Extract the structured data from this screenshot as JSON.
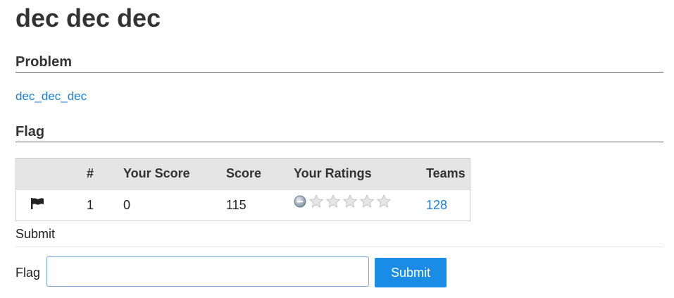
{
  "page": {
    "title": "dec dec dec"
  },
  "problem": {
    "heading": "Problem",
    "link_text": "dec_dec_dec"
  },
  "flag_section": {
    "heading": "Flag",
    "table": {
      "columns": [
        "",
        "#",
        "Your Score",
        "Score",
        "Your Ratings",
        "Teams"
      ],
      "rows": [
        {
          "icon": "flag-icon",
          "number": "1",
          "your_score": "0",
          "score": "115",
          "your_rating_stars": 0,
          "max_stars": 5,
          "teams": "128"
        }
      ]
    }
  },
  "submit_form": {
    "heading": "Submit",
    "flag_label": "Flag",
    "flag_value": "",
    "submit_label": "Submit"
  },
  "colors": {
    "link": "#1a7fd4",
    "button": "#1a8ce6",
    "header_bg": "#e5e5e5"
  }
}
